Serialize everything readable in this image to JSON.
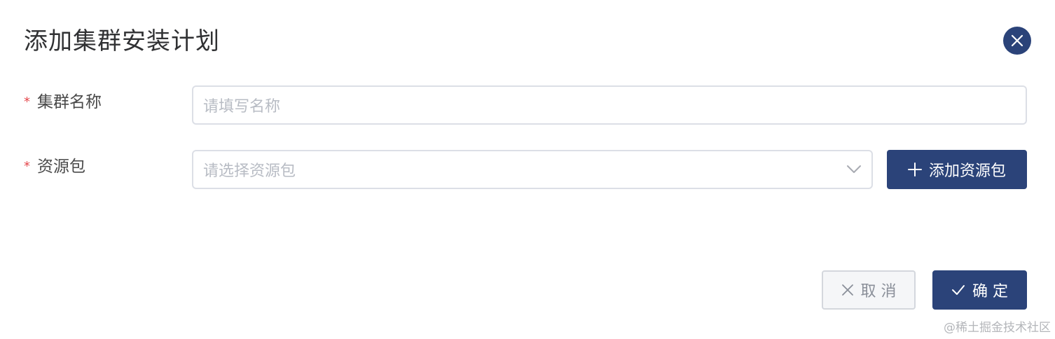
{
  "dialog": {
    "title": "添加集群安装计划",
    "close_icon": "close-icon"
  },
  "form": {
    "cluster_name": {
      "required_mark": "*",
      "label": "集群名称",
      "placeholder": "请填写名称",
      "value": ""
    },
    "resource_package": {
      "required_mark": "*",
      "label": "资源包",
      "placeholder": "请选择资源包",
      "value": "",
      "dropdown_icon": "chevron-down-icon"
    },
    "add_resource_button": {
      "icon": "plus-icon",
      "label": "添加资源包"
    }
  },
  "footer": {
    "cancel": {
      "icon": "close-icon",
      "label": "取 消"
    },
    "confirm": {
      "icon": "check-icon",
      "label": "确 定"
    }
  },
  "watermark": "@稀土掘金技术社区",
  "colors": {
    "primary": "#2b4379",
    "required": "#e5484d",
    "border": "#dcdfe6",
    "placeholder": "#b8bcc4"
  }
}
